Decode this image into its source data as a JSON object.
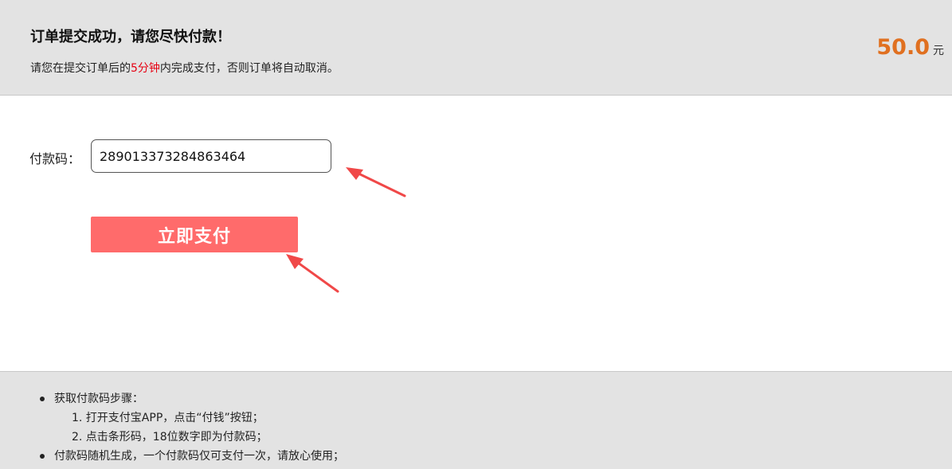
{
  "header": {
    "title": "订单提交成功，请您尽快付款！",
    "subtitle_before": "请您在提交订单后的",
    "subtitle_highlight": "5分钟",
    "subtitle_after": "内完成支付，否则订单将自动取消。",
    "amount": "50.0",
    "amount_unit": "元"
  },
  "form": {
    "code_label": "付款码：",
    "code_value": "289013373284863464",
    "pay_button": "立即支付"
  },
  "instructions": {
    "step_title": "获取付款码步骤：",
    "steps": [
      "1. 打开支付宝APP，点击“付钱”按钮；",
      "2. 点击条形码，18位数字即为付款码；"
    ],
    "note": "付款码随机生成，一个付款码仅可支付一次，请放心使用；"
  },
  "colors": {
    "highlight": "#e60012",
    "amount": "#e07020",
    "pay_button": "#ff6b6b",
    "arrow": "#f04848"
  }
}
